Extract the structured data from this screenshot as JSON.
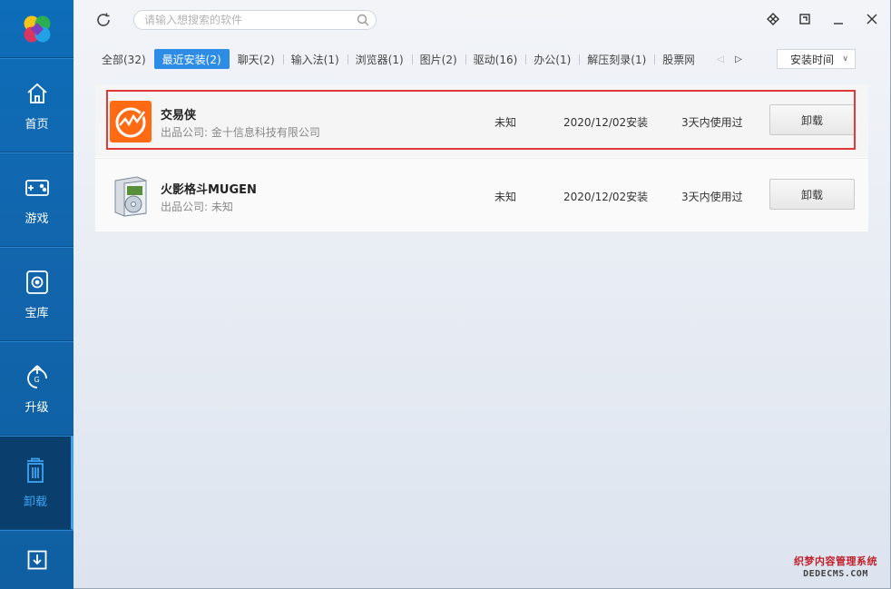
{
  "window": {
    "search_placeholder": "请输入想搜索的软件"
  },
  "sidebar": {
    "items": [
      {
        "label": "首页"
      },
      {
        "label": "游戏"
      },
      {
        "label": "宝库"
      },
      {
        "label": "升级"
      },
      {
        "label": "卸载"
      }
    ]
  },
  "tabs": [
    {
      "label": "全部(32)"
    },
    {
      "label": "最近安装(2)"
    },
    {
      "label": "聊天(2)"
    },
    {
      "label": "输入法(1)"
    },
    {
      "label": "浏览器(1)"
    },
    {
      "label": "图片(2)"
    },
    {
      "label": "驱动(16)"
    },
    {
      "label": "办公(1)"
    },
    {
      "label": "解压刻录(1)"
    },
    {
      "label": "股票网"
    }
  ],
  "sort": {
    "selected": "安装时间"
  },
  "apps": [
    {
      "name": "交易侠",
      "company": "出品公司: 金十信息科技有限公司",
      "size": "未知",
      "date": "2020/12/02安装",
      "usage": "3天内使用过",
      "action": "卸载"
    },
    {
      "name": "火影格斗MUGEN",
      "company": "出品公司: 未知",
      "size": "未知",
      "date": "2020/12/02安装",
      "usage": "3天内使用过",
      "action": "卸载"
    }
  ],
  "watermark": {
    "line1": "织梦内容管理系统",
    "line2": "DEDECMS.COM"
  },
  "colors": {
    "sidebar": "#1266ad",
    "accent": "#2d8ce6",
    "highlight": "#e03a3a",
    "app1_icon": "#ff6a13"
  },
  "icons": [
    "logo-icon",
    "home-icon",
    "gamepad-icon",
    "vault-icon",
    "upgrade-icon",
    "uninstall-icon",
    "download-icon",
    "refresh-icon",
    "search-icon",
    "skin-icon",
    "restore-icon",
    "minimize-icon",
    "close-icon",
    "chevron-left-icon",
    "chevron-right-icon",
    "chevron-down-icon"
  ]
}
